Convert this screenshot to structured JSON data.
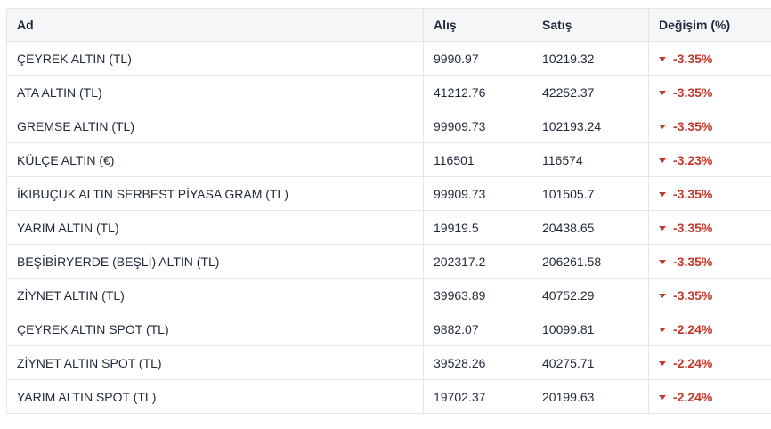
{
  "table": {
    "headers": {
      "name": "Ad",
      "buy": "Alış",
      "sell": "Satış",
      "change": "Değişim (%)"
    },
    "colors": {
      "negative": "#c0392b",
      "header_bg": "#f5f6f8",
      "border": "#e3e6ea"
    },
    "rows": [
      {
        "name": "ÇEYREK ALTIN (TL)",
        "buy": "9990.97",
        "sell": "10219.32",
        "change": "-3.35%",
        "direction_icon": "caret-down-icon"
      },
      {
        "name": "ATA ALTIN (TL)",
        "buy": "41212.76",
        "sell": "42252.37",
        "change": "-3.35%",
        "direction_icon": "caret-down-icon"
      },
      {
        "name": "GREMSE ALTIN (TL)",
        "buy": "99909.73",
        "sell": "102193.24",
        "change": "-3.35%",
        "direction_icon": "caret-down-icon"
      },
      {
        "name": "KÜLÇE ALTIN (€)",
        "buy": "116501",
        "sell": "116574",
        "change": "-3.23%",
        "direction_icon": "caret-down-icon"
      },
      {
        "name": "İKIBUÇUK ALTIN SERBEST PİYASA GRAM (TL)",
        "buy": "99909.73",
        "sell": "101505.7",
        "change": "-3.35%",
        "direction_icon": "caret-down-icon"
      },
      {
        "name": "YARIM ALTIN (TL)",
        "buy": "19919.5",
        "sell": "20438.65",
        "change": "-3.35%",
        "direction_icon": "caret-down-icon"
      },
      {
        "name": "BEŞİBİRYERDE (BEŞLİ) ALTIN (TL)",
        "buy": "202317.2",
        "sell": "206261.58",
        "change": "-3.35%",
        "direction_icon": "caret-down-icon"
      },
      {
        "name": "ZİYNET ALTIN (TL)",
        "buy": "39963.89",
        "sell": "40752.29",
        "change": "-3.35%",
        "direction_icon": "caret-down-icon"
      },
      {
        "name": "ÇEYREK ALTIN SPOT (TL)",
        "buy": "9882.07",
        "sell": "10099.81",
        "change": "-2.24%",
        "direction_icon": "caret-down-icon"
      },
      {
        "name": "ZİYNET ALTIN SPOT (TL)",
        "buy": "39528.26",
        "sell": "40275.71",
        "change": "-2.24%",
        "direction_icon": "caret-down-icon"
      },
      {
        "name": "YARIM ALTIN SPOT (TL)",
        "buy": "19702.37",
        "sell": "20199.63",
        "change": "-2.24%",
        "direction_icon": "caret-down-icon"
      }
    ]
  }
}
